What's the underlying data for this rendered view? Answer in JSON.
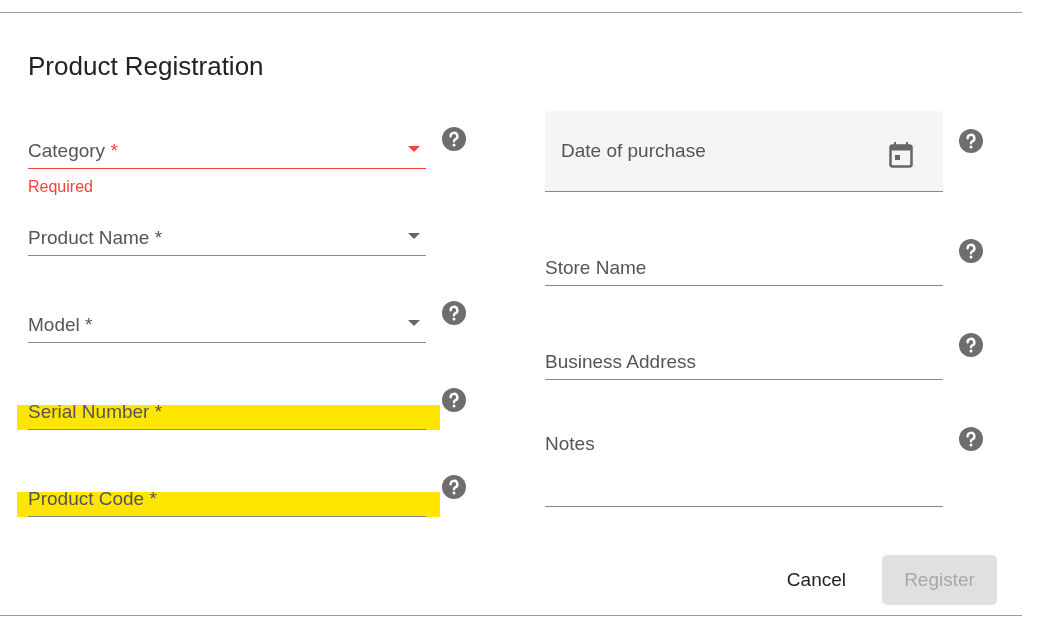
{
  "dialog": {
    "title": "Product Registration"
  },
  "left_fields": [
    {
      "label": "Category",
      "required_mark": "*",
      "kind": "select",
      "error": true,
      "helper": "Required",
      "help": true,
      "highlighted": false
    },
    {
      "label": "Product Name",
      "required_mark": "*",
      "kind": "select",
      "error": false,
      "help": false,
      "highlighted": false
    },
    {
      "label": "Model",
      "required_mark": "*",
      "kind": "select",
      "error": false,
      "help": true,
      "highlighted": false
    },
    {
      "label": "Serial Number",
      "required_mark": "*",
      "kind": "text",
      "error": false,
      "help": true,
      "highlighted": true
    },
    {
      "label": "Product Code",
      "required_mark": "*",
      "kind": "text",
      "error": false,
      "help": true,
      "highlighted": true
    }
  ],
  "right_fields": [
    {
      "label": "Date of purchase",
      "kind": "date",
      "help": true
    },
    {
      "label": "Store Name",
      "kind": "text",
      "help": true
    },
    {
      "label": "Business Address",
      "kind": "text",
      "help": true
    },
    {
      "label": "Notes",
      "kind": "textarea",
      "help": true
    }
  ],
  "buttons": [
    {
      "label": "Cancel",
      "kind": "text",
      "disabled": false
    },
    {
      "label": "Register",
      "kind": "contained",
      "disabled": true
    }
  ]
}
